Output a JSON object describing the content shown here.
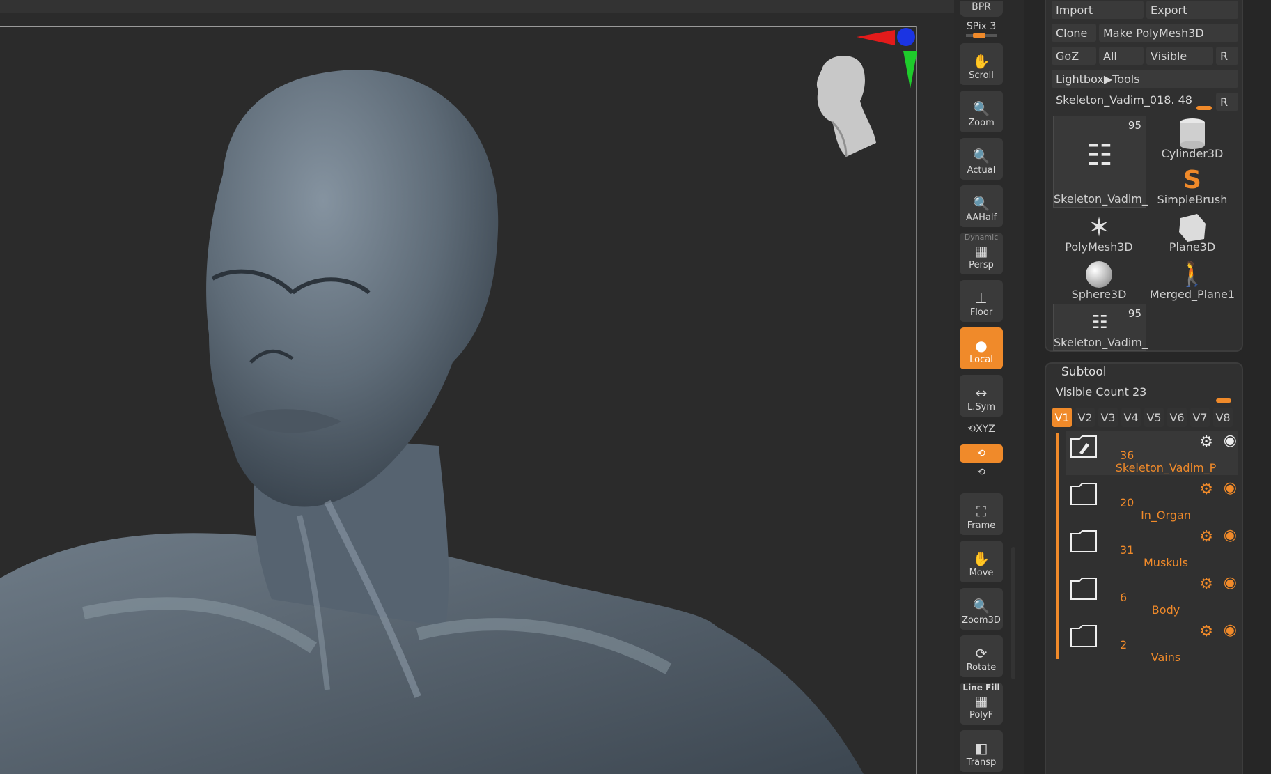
{
  "colors": {
    "accent": "#f08a2a",
    "panel": "#303030",
    "viewport": "#2b2b2b"
  },
  "viewport": {
    "model": "anatomy-figure"
  },
  "shelf": {
    "bpr_label": "BPR",
    "spix_label": "SPix 3",
    "scroll_label": "Scroll",
    "zoom_label": "Zoom",
    "actual_label": "Actual",
    "aahalf_label": "AAHalf",
    "dynamic_label": "Dynamic",
    "persp_label": "Persp",
    "floor_label": "Floor",
    "local_label": "Local",
    "lsym_label": "L.Sym",
    "xyz_label": "XYZ",
    "frame_label": "Frame",
    "move_label": "Move",
    "zoom3d_label": "Zoom3D",
    "rotate_label": "Rotate",
    "linefill_label": "Line Fill",
    "polyf_label": "PolyF",
    "transp_label": "Transp"
  },
  "tool_panel": {
    "import_label": "Import",
    "export_label": "Export",
    "clone_label": "Clone",
    "make_polymesh_label": "Make PolyMesh3D",
    "goz_label": "GoZ",
    "all_label": "All",
    "visible_label": "Visible",
    "r_label": "R",
    "lightbox_label": "Lightbox▶Tools",
    "current_tool_label": "Skeleton_Vadim_018. 48",
    "current_tool_r": "R",
    "tiles": [
      {
        "label": "Skeleton_Vadim_",
        "count": "95"
      },
      {
        "label": "Cylinder3D",
        "count": ""
      },
      {
        "label": "SimpleBrush",
        "count": ""
      },
      {
        "label": "PolyMesh3D",
        "count": ""
      },
      {
        "label": "Plane3D",
        "count": ""
      },
      {
        "label": "Sphere3D",
        "count": ""
      },
      {
        "label": "Merged_Plane1",
        "count": ""
      },
      {
        "label": "Skeleton_Vadim_",
        "count": "95"
      }
    ]
  },
  "subtool": {
    "title": "Subtool",
    "visible_count_label": "Visible Count 23",
    "tabs": [
      "V1",
      "V2",
      "V3",
      "V4",
      "V5",
      "V6",
      "V7",
      "V8"
    ],
    "rows": [
      {
        "count": "36",
        "name": "Skeleton_Vadim_P"
      },
      {
        "count": "20",
        "name": "In_Organ"
      },
      {
        "count": "31",
        "name": "Muskuls"
      },
      {
        "count": "6",
        "name": "Body"
      },
      {
        "count": "2",
        "name": "Vains"
      }
    ]
  }
}
